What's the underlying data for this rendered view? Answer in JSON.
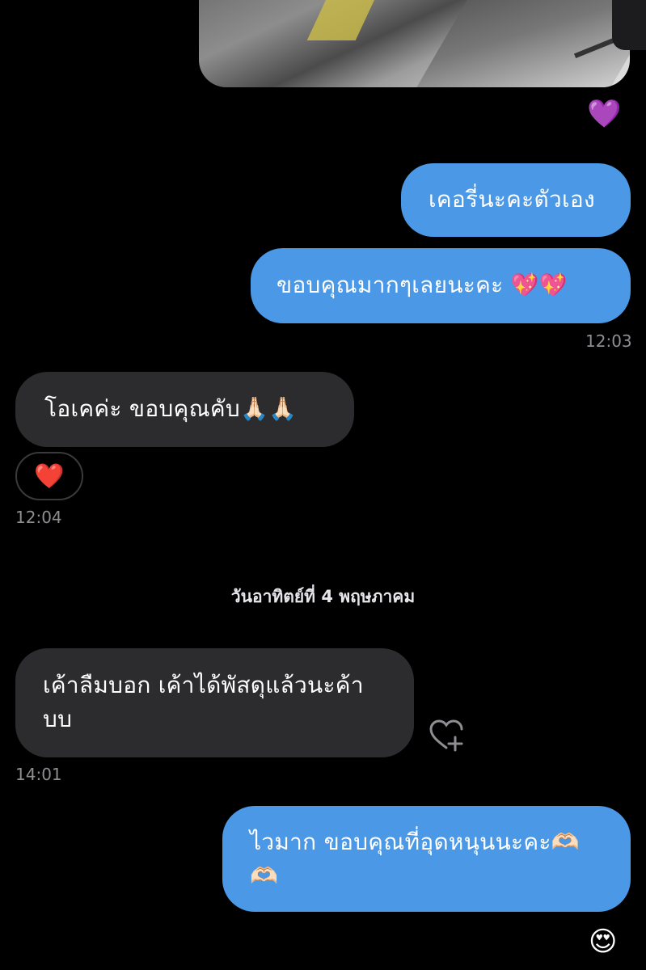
{
  "messages": {
    "m1": "เคอรี่นะคะตัวเอง",
    "m2": "ขอบคุณมากๆเลยนะคะ 💖💖",
    "time1": "12:03",
    "m3": "โอเคค่ะ ขอบคุณคับ🙏🏻🙏🏻",
    "reaction": "❤️",
    "time2": "12:04",
    "date_separator": "วันอาทิตย์ที่ 4 พฤษภาคม",
    "m4_line1": "เค้าลืมบอก เค้าได้พัสดุแล้วนะค้า",
    "m4_line2": "บบ",
    "time3": "14:01",
    "m5_line1": "ไวมาก ขอบคุณที่อุดหนุนนะคะ🫶🏻",
    "m5_line2": "🫶🏻"
  },
  "reactions": {
    "photo_reaction": "💜",
    "last_reaction": "😍"
  },
  "icons": {
    "add_reaction": "heart-plus-icon"
  },
  "colors": {
    "outgoing_bubble": "#4a98e6",
    "incoming_bubble": "#2c2c2e",
    "background": "#000000"
  }
}
